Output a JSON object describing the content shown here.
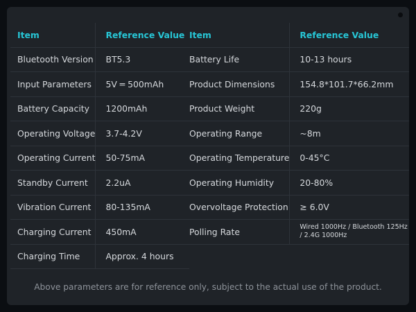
{
  "headers": {
    "item": "Item",
    "ref": "Reference Value"
  },
  "left_rows": [
    {
      "item": "Bluetooth Version",
      "value": "BT5.3"
    },
    {
      "item": "Input Parameters",
      "value": "5V ═ 500mAh"
    },
    {
      "item": "Battery Capacity",
      "value": "1200mAh"
    },
    {
      "item": "Operating Voltage",
      "value": "3.7-4.2V"
    },
    {
      "item": "Operating Current",
      "value": "50-75mA"
    },
    {
      "item": "Standby Current",
      "value": "2.2uA"
    },
    {
      "item": "Vibration Current",
      "value": "80-135mA"
    },
    {
      "item": "Charging Current",
      "value": "450mA"
    },
    {
      "item": "Charging Time",
      "value": "Approx. 4 hours"
    }
  ],
  "right_rows": [
    {
      "item": "Battery Life",
      "value": "10-13 hours"
    },
    {
      "item": "Product Dimensions",
      "value": "154.8*101.7*66.2mm"
    },
    {
      "item": "Product Weight",
      "value": "220g"
    },
    {
      "item": "Operating Range",
      "value": "~8m"
    },
    {
      "item": "Operating Temperature",
      "value": "0-45°C"
    },
    {
      "item": "Operating Humidity",
      "value": "20-80%"
    },
    {
      "item": "Overvoltage Protection",
      "value": "≥ 6.0V"
    },
    {
      "item": "Polling Rate",
      "value": "Wired 1000Hz / Bluetooth 125Hz / 2.4G 1000Hz"
    }
  ],
  "footer": "Above parameters are for reference only, subject to the actual use of the product.",
  "colors": {
    "accent": "#27c6d6",
    "panel": "#1f2328",
    "background": "#0b0e12"
  }
}
